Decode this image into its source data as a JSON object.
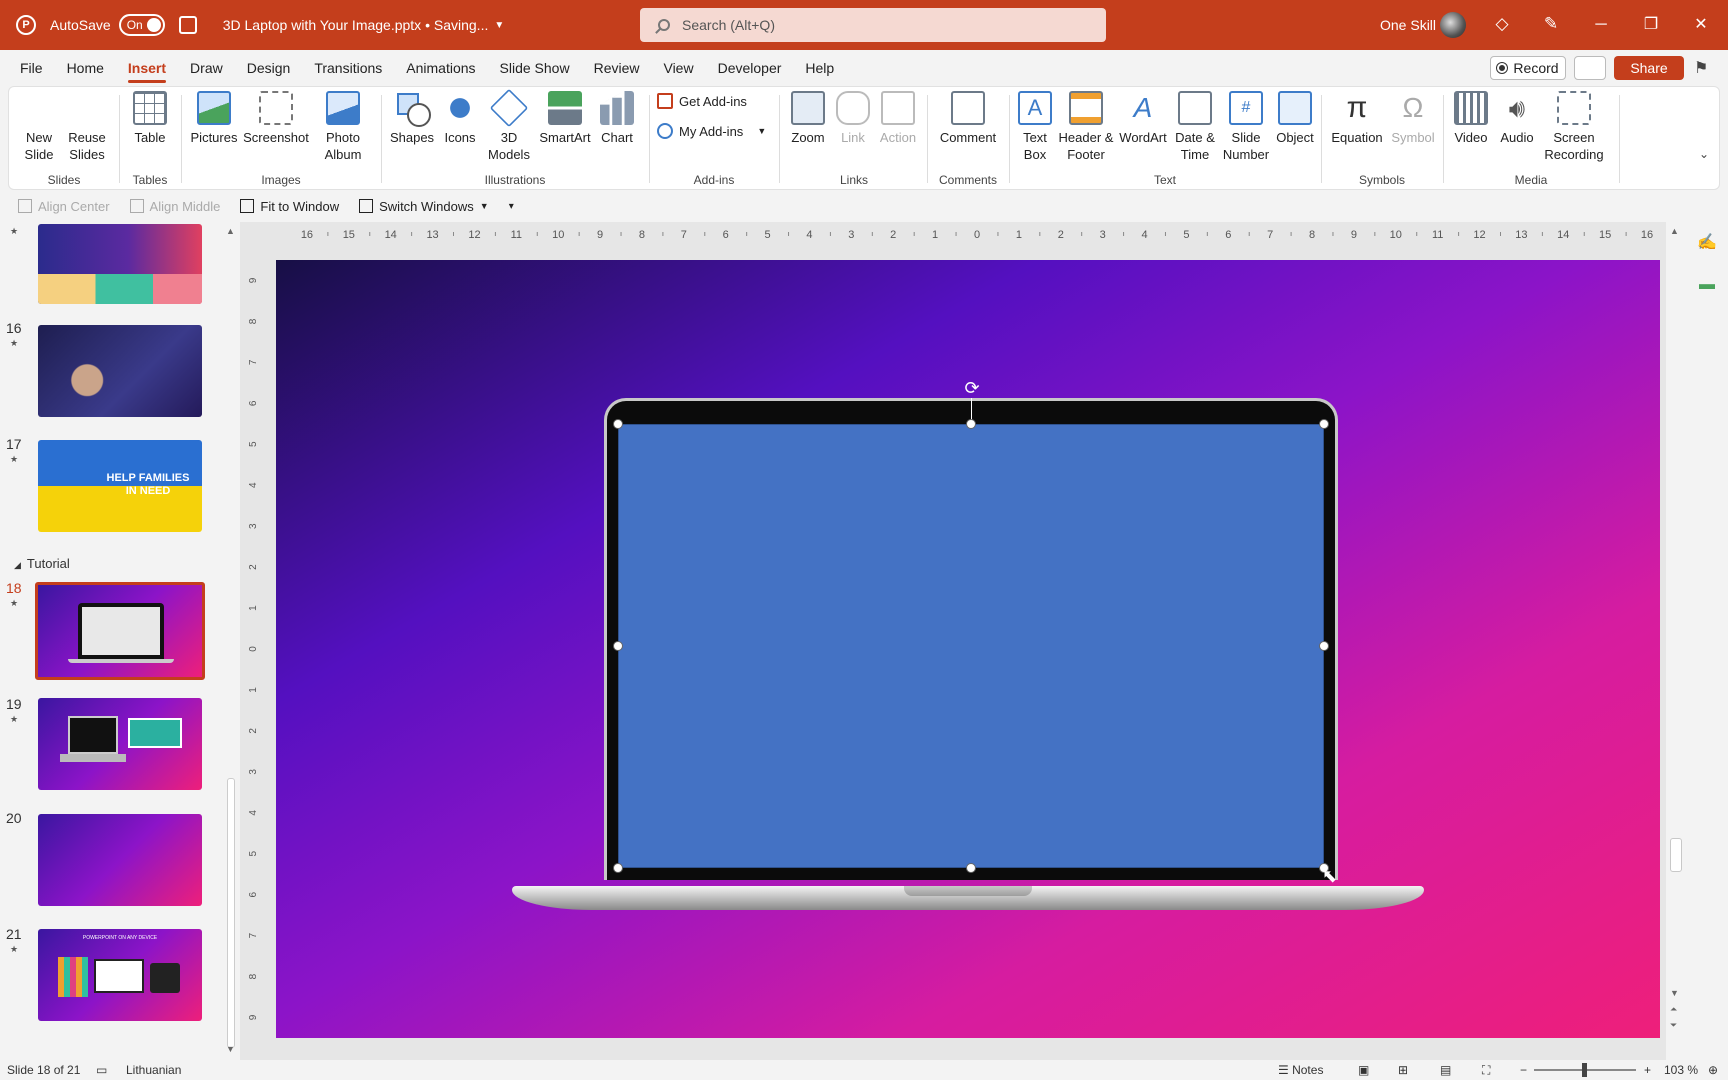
{
  "titlebar": {
    "autosave_label": "AutoSave",
    "autosave_state": "On",
    "doc_title": "3D Laptop with Your Image.pptx • Saving...",
    "search_placeholder": "Search (Alt+Q)",
    "user_name": "One Skill"
  },
  "menu": {
    "tabs": [
      "File",
      "Home",
      "Insert",
      "Draw",
      "Design",
      "Transitions",
      "Animations",
      "Slide Show",
      "Review",
      "View",
      "Developer",
      "Help"
    ],
    "active": "Insert",
    "record_label": "Record",
    "share_label": "Share"
  },
  "ribbon": {
    "groups": {
      "slides": "Slides",
      "tables": "Tables",
      "images": "Images",
      "illustrations": "Illustrations",
      "addins": "Add-ins",
      "links": "Links",
      "comments": "Comments",
      "text": "Text",
      "symbols": "Symbols",
      "media": "Media"
    },
    "buttons": {
      "new_slide": "New Slide",
      "reuse_slides": "Reuse Slides",
      "table": "Table",
      "pictures": "Pictures",
      "screenshot": "Screenshot",
      "photo_album": "Photo Album",
      "shapes": "Shapes",
      "icons": "Icons",
      "models_3d": "3D Models",
      "smartart": "SmartArt",
      "chart": "Chart",
      "get_addins": "Get Add-ins",
      "my_addins": "My Add-ins",
      "zoom": "Zoom",
      "link": "Link",
      "action": "Action",
      "comment": "Comment",
      "text_box": "Text Box",
      "header_footer": "Header & Footer",
      "wordart": "WordArt",
      "date_time": "Date & Time",
      "slide_number": "Slide Number",
      "object": "Object",
      "equation": "Equation",
      "symbol": "Symbol",
      "video": "Video",
      "audio": "Audio",
      "screen_recording": "Screen Recording"
    }
  },
  "qat": {
    "align_center": "Align Center",
    "align_middle": "Align Middle",
    "fit_to_window": "Fit to Window",
    "switch_windows": "Switch Windows"
  },
  "thumbnails": {
    "section_label": "Tutorial",
    "slides": [
      {
        "num": "16",
        "text": "",
        "bg": "#2a2a6a"
      },
      {
        "num": "17",
        "text": "HELP FAMILIES IN NEED",
        "bg": "#2a6fd1"
      },
      {
        "num": "18",
        "text": "",
        "bg": "#8c14c8"
      },
      {
        "num": "19",
        "text": "",
        "bg": "#8c14c8"
      },
      {
        "num": "20",
        "text": "",
        "bg": "#8c14c8"
      },
      {
        "num": "21",
        "text": "POWERPOINT ON ANY DEVICE",
        "bg": "#8c14c8"
      }
    ],
    "selected": "18"
  },
  "ruler": {
    "h_ticks": [
      "16",
      "15",
      "14",
      "13",
      "12",
      "11",
      "10",
      "9",
      "8",
      "7",
      "6",
      "5",
      "4",
      "3",
      "2",
      "1",
      "0",
      "1",
      "2",
      "3",
      "4",
      "5",
      "6",
      "7",
      "8",
      "9",
      "10",
      "11",
      "12",
      "13",
      "14",
      "15",
      "16"
    ],
    "v_ticks": [
      "9",
      "8",
      "7",
      "6",
      "5",
      "4",
      "3",
      "2",
      "1",
      "0",
      "1",
      "2",
      "3",
      "4",
      "5",
      "6",
      "7",
      "8",
      "9"
    ]
  },
  "statusbar": {
    "slide_info": "Slide 18 of 21",
    "language": "Lithuanian",
    "notes": "Notes",
    "zoom": "103 %"
  },
  "colors": {
    "accent": "#c43e1c",
    "shape_fill": "#4472c4"
  }
}
